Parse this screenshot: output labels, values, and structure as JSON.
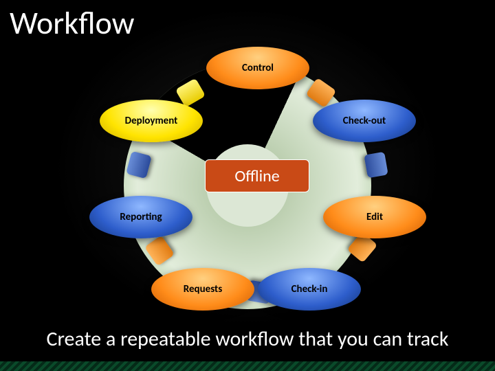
{
  "title": "Workflow",
  "subtitle": "Create a repeatable workflow that you can track",
  "center_label": "Offline",
  "nodes": {
    "control": "Control",
    "checkout": "Check-out",
    "edit": "Edit",
    "checkin": "Check-in",
    "requests": "Requests",
    "reporting": "Reporting",
    "deployment": "Deployment"
  },
  "chart_data": {
    "type": "cycle-diagram",
    "title": "Workflow",
    "center": "Offline",
    "steps": [
      {
        "label": "Control",
        "color": "orange"
      },
      {
        "label": "Check-out",
        "color": "blue"
      },
      {
        "label": "Edit",
        "color": "orange"
      },
      {
        "label": "Check-in",
        "color": "blue"
      },
      {
        "label": "Requests",
        "color": "orange"
      },
      {
        "label": "Reporting",
        "color": "blue"
      },
      {
        "label": "Deployment",
        "color": "yellow"
      }
    ],
    "annotation": "Create a repeatable workflow that you can track"
  }
}
